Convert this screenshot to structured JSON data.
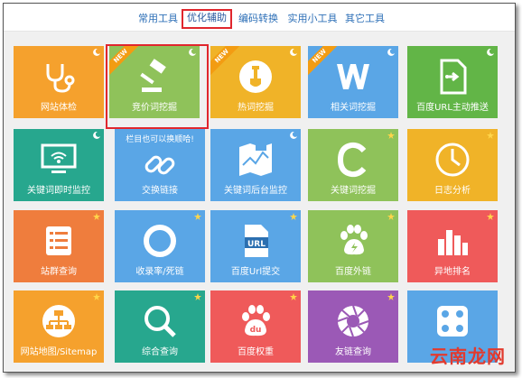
{
  "tabs": [
    {
      "label": "常用工具",
      "active": false
    },
    {
      "label": "优化辅助",
      "active": true
    },
    {
      "label": "编码转换",
      "active": false
    },
    {
      "label": "实用小工具",
      "active": false
    },
    {
      "label": "其它工具",
      "active": false
    }
  ],
  "tiles": [
    {
      "label": "网站体检",
      "color": "#f5a12d",
      "icon": "stethoscope-icon",
      "corner": "moon",
      "new": false
    },
    {
      "label": "竞价词挖掘",
      "color": "#8fc25a",
      "icon": "gavel-icon",
      "corner": "moon",
      "new": true
    },
    {
      "label": "热词挖掘",
      "color": "#f0b328",
      "icon": "shovel-icon",
      "corner": "moon",
      "new": true
    },
    {
      "label": "相关词挖掘",
      "color": "#5aa6e6",
      "icon": "w-letter-icon",
      "corner": "moon",
      "new": true
    },
    {
      "label": "百度URL主动推送",
      "color": "#62b547",
      "icon": "file-push-icon",
      "corner": "moon",
      "new": false
    },
    {
      "label": "关键词即时监控",
      "color": "#27a78e",
      "icon": "monitor-wifi-icon",
      "corner": "moon",
      "new": false
    },
    {
      "label": "交换链接",
      "color": "#5aa6e6",
      "icon": "chain-link-icon",
      "corner": "none",
      "new": false,
      "note": "栏目也可以换顺哈!"
    },
    {
      "label": "关键词后台监控",
      "color": "#5aa6e6",
      "icon": "map-chart-icon",
      "corner": "moon",
      "new": false
    },
    {
      "label": "关键词挖掘",
      "color": "#8fc25a",
      "icon": "c-letter-icon",
      "corner": "star",
      "new": false
    },
    {
      "label": "日志分析",
      "color": "#f0b328",
      "icon": "clock-icon",
      "corner": "star",
      "new": false
    },
    {
      "label": "站群查询",
      "color": "#ef7d3d",
      "icon": "list-icon",
      "corner": "star",
      "new": false
    },
    {
      "label": "收录率/死链",
      "color": "#5aa6e6",
      "icon": "ring-icon",
      "corner": "star",
      "new": false
    },
    {
      "label": "百度Url提交",
      "color": "#5aa6e6",
      "icon": "url-file-icon",
      "corner": "star",
      "new": false
    },
    {
      "label": "百度外链",
      "color": "#8fc25a",
      "icon": "paw-icon",
      "corner": "star",
      "new": false
    },
    {
      "label": "异地排名",
      "color": "#ef5a5a",
      "icon": "bar-chart-icon",
      "corner": "star",
      "new": false
    },
    {
      "label": "网站地图/Sitemap",
      "color": "#f5a12d",
      "icon": "sitemap-icon",
      "corner": "star",
      "new": false
    },
    {
      "label": "综合查询",
      "color": "#27a78e",
      "icon": "magnifier-icon",
      "corner": "star",
      "new": false
    },
    {
      "label": "百度权重",
      "color": "#ef5a5a",
      "icon": "du-paw-icon",
      "corner": "star",
      "new": false
    },
    {
      "label": "友链查询",
      "color": "#9b59b6",
      "icon": "aperture-icon",
      "corner": "star",
      "new": false
    },
    {
      "label": "",
      "color": "#5aa6e6",
      "icon": "dice-icon",
      "corner": "none",
      "new": false
    }
  ],
  "badge": {
    "new_text": "NEW"
  },
  "watermark": "云南龙网"
}
